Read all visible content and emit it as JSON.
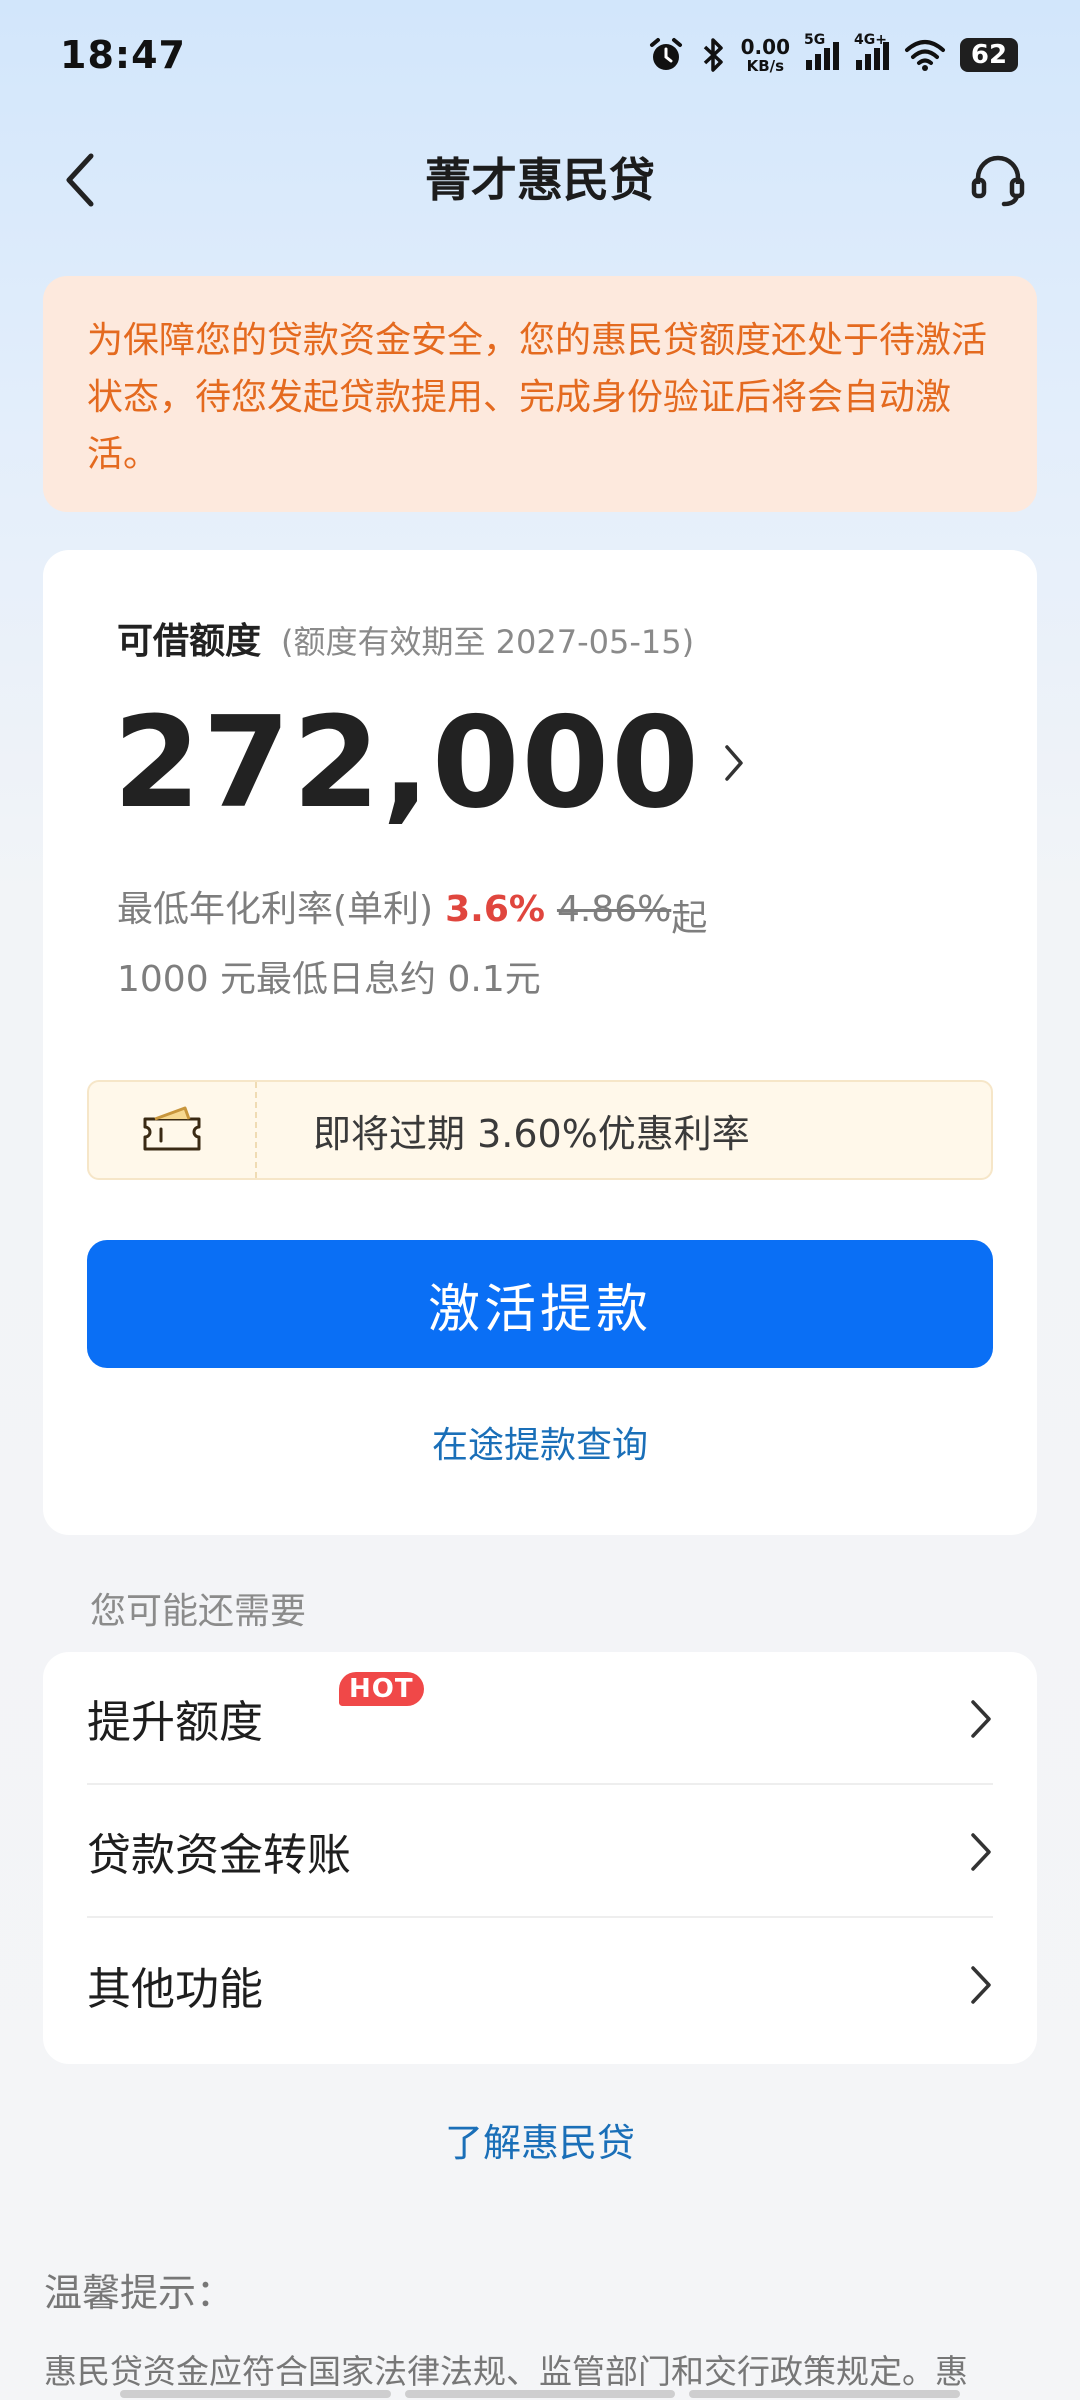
{
  "status_bar": {
    "time": "18:47",
    "net_speed_value": "0.00",
    "net_speed_unit": "KB/s",
    "signal1_label": "5G",
    "signal2_label": "4G+",
    "battery": "62"
  },
  "nav": {
    "title": "菁才惠民贷"
  },
  "notice": {
    "text": "为保障您的贷款资金安全，您的惠民贷额度还处于待激活状态，待您发起贷款提用、完成身份验证后将会自动激活。"
  },
  "quota": {
    "label": "可借额度",
    "validity": "(额度有效期至 2027-05-15)",
    "amount": "272,000",
    "rate_prefix": "最低年化利率(单利)",
    "rate_now": "3.6%",
    "rate_old": "4.86%",
    "rate_suffix": "起",
    "daily_interest": "1000 元最低日息约 0.1元"
  },
  "coupon": {
    "text": "即将过期 3.60%优惠利率",
    "icon": "coupon-icon"
  },
  "actions": {
    "activate_label": "激活提款",
    "transit_label": "在途提款查询"
  },
  "more": {
    "heading": "您可能还需要",
    "items": [
      {
        "label": "提升额度",
        "badge": "HOT"
      },
      {
        "label": "贷款资金转账"
      },
      {
        "label": "其他功能"
      }
    ]
  },
  "learn_more": "了解惠民贷",
  "tips": {
    "title": "温馨提示：",
    "body": "惠民贷资金应符合国家法律法规、监管部门和交行政策规定。惠"
  },
  "colors": {
    "primary": "#0a6ff5",
    "link": "#1a6fb8",
    "notice_text": "#e46a1f",
    "notice_bg": "#fde9dd",
    "rate_red": "#e0463e",
    "hot_badge": "#f04848"
  }
}
